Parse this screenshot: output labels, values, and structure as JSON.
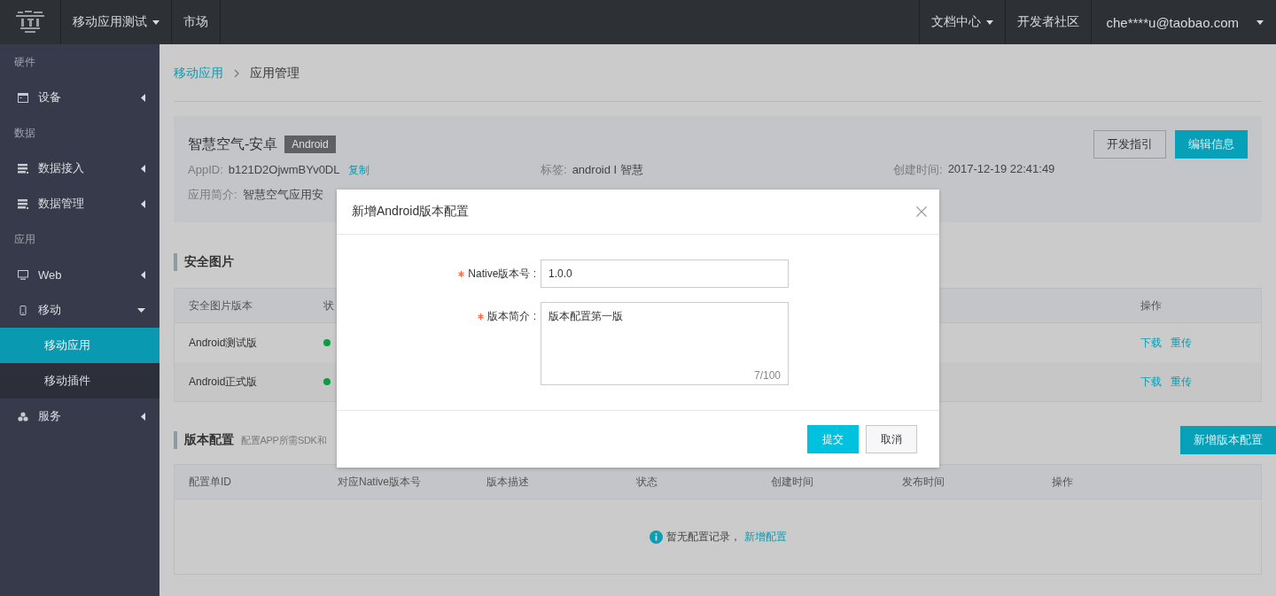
{
  "topbar": {
    "left": [
      {
        "label": "移动应用测试",
        "dropdown": true
      },
      {
        "label": "市场",
        "dropdown": false
      }
    ],
    "right": [
      {
        "label": "文档中心",
        "dropdown": true
      },
      {
        "label": "开发者社区",
        "dropdown": false
      },
      {
        "label": "che****u@taobao.com",
        "dropdown": true
      }
    ]
  },
  "sidebar": [
    {
      "heading": "硬件",
      "items": [
        {
          "label": "设备",
          "expanded": false,
          "selected": false
        }
      ]
    },
    {
      "heading": "数据",
      "items": [
        {
          "label": "数据接入",
          "expanded": false,
          "selected": false
        },
        {
          "label": "数据管理",
          "expanded": false,
          "selected": false
        }
      ]
    },
    {
      "heading": "应用",
      "items": [
        {
          "label": "Web",
          "expanded": false,
          "selected": false
        },
        {
          "label": "移动",
          "expanded": true,
          "selected": false,
          "children": [
            {
              "label": "移动应用",
              "selected": true
            },
            {
              "label": "移动插件",
              "selected": false
            }
          ]
        },
        {
          "label": "服务",
          "expanded": false,
          "selected": false
        }
      ]
    }
  ],
  "breadcrumb": [
    {
      "label": "移动应用",
      "link": true
    },
    {
      "label": "应用管理",
      "link": false
    }
  ],
  "app": {
    "name": "智慧空气-安卓",
    "platform": "Android",
    "buttons": [
      {
        "label": "开发指引",
        "primary": false
      },
      {
        "label": "编辑信息",
        "primary": true
      }
    ],
    "appid_label": "AppID:",
    "appid": "b121D2OjwmBYv0DL",
    "copy": "复制",
    "tags_label": "标签:",
    "tags": "android I 智慧",
    "created_label": "创建时间:",
    "created": "2017-12-19 22:41:49",
    "intro_label": "应用简介:",
    "intro": "智慧空气应用安"
  },
  "security_images": {
    "title": "安全图片",
    "columns": [
      "安全图片版本",
      "状",
      "操作"
    ],
    "rows": [
      {
        "name": "Android测试版",
        "color": "#0b9e3e",
        "actions": [
          "下载",
          "重传"
        ]
      },
      {
        "name": "Android正式版",
        "color": "#0b9e3e",
        "actions": [
          "下载",
          "重传"
        ]
      }
    ]
  },
  "version_config": {
    "title": "版本配置",
    "description": "配置APP所需SDK和",
    "add_button": "新增版本配置",
    "columns": [
      "配置单ID",
      "对应Native版本号",
      "版本描述",
      "状态",
      "创建时间",
      "发布时间",
      "操作"
    ],
    "empty_text": "暂无配置记录，",
    "empty_link": "新增配置"
  },
  "dialog": {
    "title": "新增Android版本配置",
    "fields": [
      {
        "kind": "input",
        "required": true,
        "label": "Native版本号 :",
        "value": "1.0.0"
      },
      {
        "kind": "textarea",
        "required": true,
        "label": "版本简介 :",
        "value": "版本配置第一版",
        "counter": "7/100"
      }
    ],
    "buttons": [
      {
        "label": "提交",
        "primary": true
      },
      {
        "label": "取消",
        "primary": false
      }
    ]
  }
}
